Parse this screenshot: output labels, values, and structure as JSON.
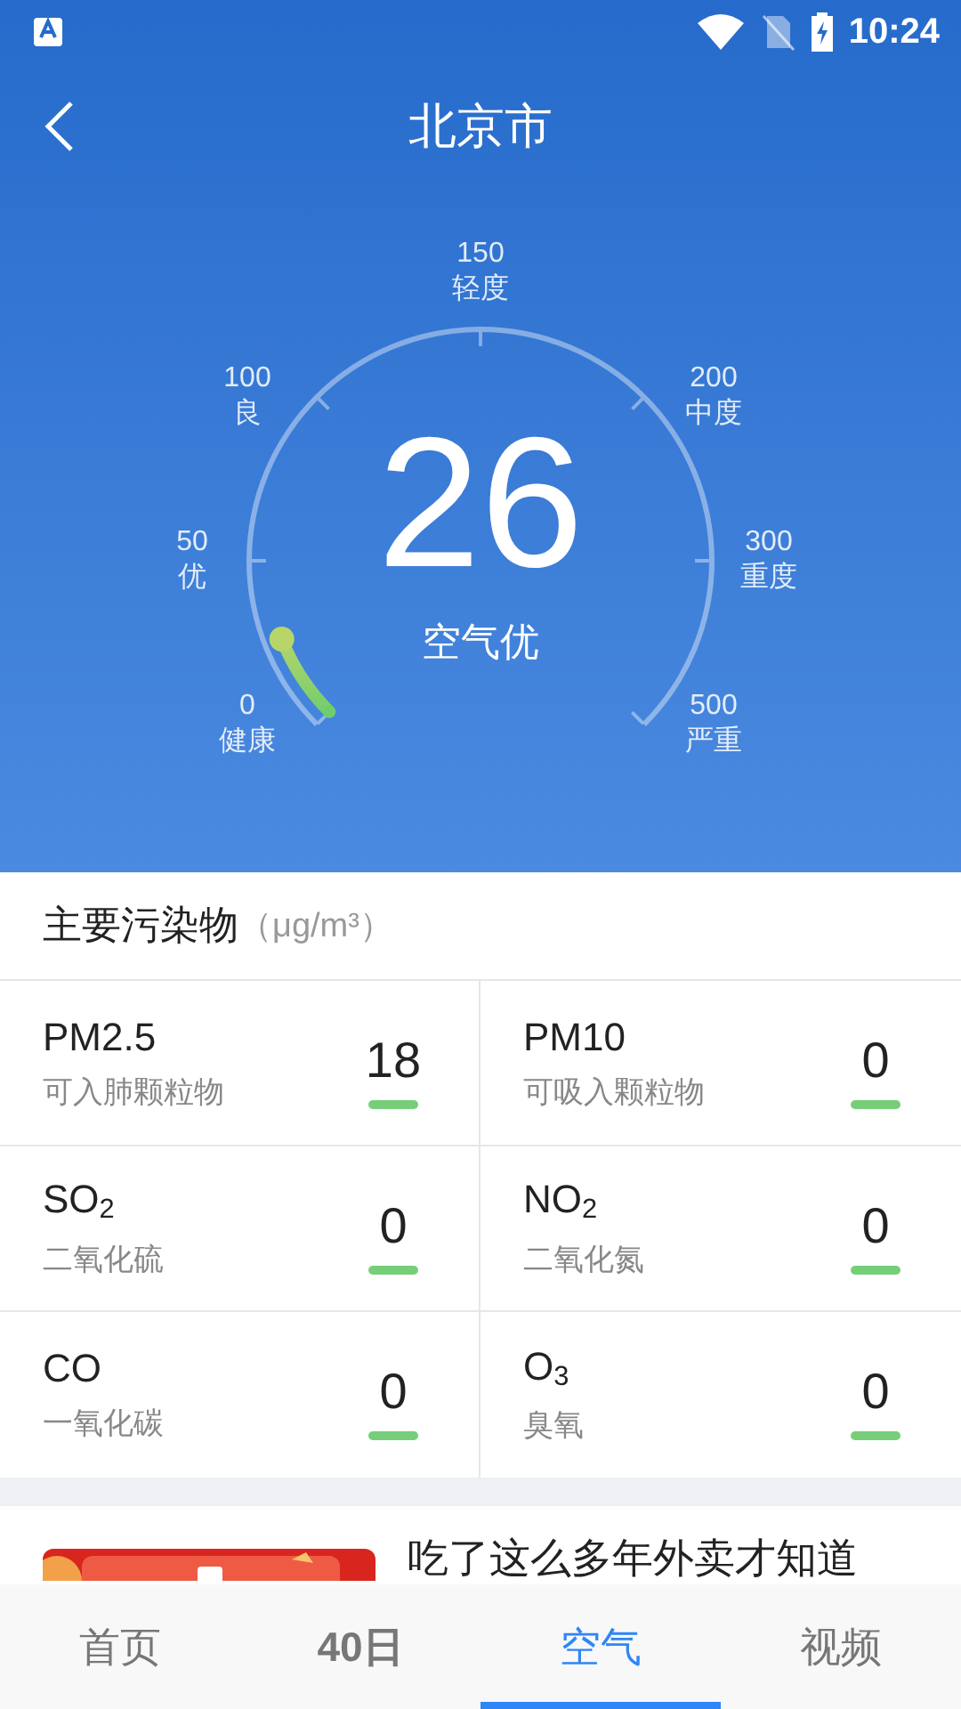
{
  "status_bar": {
    "time": "10:24"
  },
  "header": {
    "title": "北京市"
  },
  "gauge": {
    "value": "26",
    "status": "空气优",
    "level": 0.087,
    "ticks": [
      {
        "value": "0",
        "label": "健康"
      },
      {
        "value": "50",
        "label": "优"
      },
      {
        "value": "100",
        "label": "良"
      },
      {
        "value": "150",
        "label": "轻度"
      },
      {
        "value": "200",
        "label": "中度"
      },
      {
        "value": "300",
        "label": "重度"
      },
      {
        "value": "500",
        "label": "严重"
      }
    ]
  },
  "pollutants": {
    "title": "主要污染物",
    "unit": "（μg/m³）",
    "items": [
      {
        "name": "PM2.5",
        "desc": "可入肺颗粒物",
        "value": "18",
        "color": "#76cf78"
      },
      {
        "name": "PM10",
        "desc": "可吸入颗粒物",
        "value": "0",
        "color": "#76cf78"
      },
      {
        "name": "SO$_{2}$",
        "desc": "二氧化硫",
        "value": "0",
        "color": "#76cf78"
      },
      {
        "name": "NO$_{2}$",
        "desc": "二氧化氮",
        "value": "0",
        "color": "#76cf78"
      },
      {
        "name": "CO",
        "desc": "一氧化碳",
        "value": "0",
        "color": "#76cf78"
      },
      {
        "name": "O$_{3}$",
        "desc": "臭氧",
        "value": "0",
        "color": "#76cf78"
      }
    ]
  },
  "ad": {
    "kind": "picture",
    "headline": "吃了这么多年外卖才知道"
  },
  "tabs": [
    {
      "label": "首页",
      "selected": false
    },
    {
      "label": "40日",
      "selected": false
    },
    {
      "label": "空气",
      "selected": true
    },
    {
      "label": "视频",
      "selected": false
    }
  ]
}
